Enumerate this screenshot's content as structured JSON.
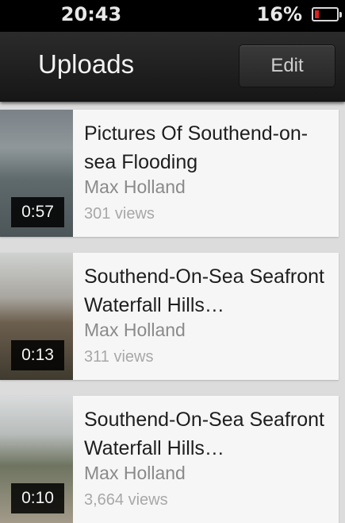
{
  "status_bar": {
    "time": "20:43",
    "battery_percent": "16%",
    "battery_level": 0.16,
    "battery_color": "#e02020"
  },
  "nav": {
    "title": "Uploads",
    "edit_label": "Edit"
  },
  "videos": [
    {
      "title": "Pictures Of Southend-on-sea Flooding",
      "author": "Max Holland",
      "views": "301 views",
      "duration": "0:57"
    },
    {
      "title": "Southend-On-Sea Seafront Waterfall Hills…",
      "author": "Max Holland",
      "views": "311 views",
      "duration": "0:13"
    },
    {
      "title": "Southend-On-Sea Seafront Waterfall Hills…",
      "author": "Max Holland",
      "views": "3,664 views",
      "duration": "0:10"
    }
  ]
}
